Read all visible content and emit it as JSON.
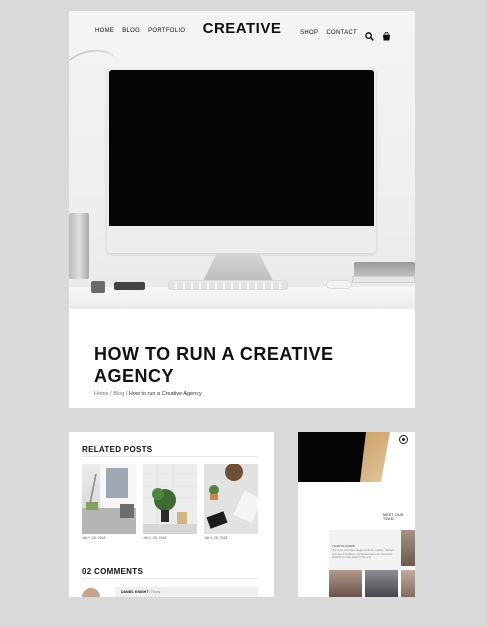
{
  "nav": {
    "left_links": [
      "HOME",
      "BLOG",
      "PORTFOLIO"
    ],
    "logo": "CREATIVE",
    "right_links": [
      "SHOP",
      "CONTACT"
    ],
    "icons": [
      "search-icon",
      "cart-icon"
    ]
  },
  "post": {
    "title": "HOW TO RUN A CREATIVE AGENCY",
    "breadcrumb": {
      "home": "Home",
      "sep": "/",
      "blog": "Blog",
      "current": "How to run a Creative Agency"
    }
  },
  "related": {
    "title": "RELATED POSTS",
    "posts": [
      {
        "date": "JULY, 25, 2018"
      },
      {
        "date": "JULY, 25, 2018"
      },
      {
        "date": "JULY, 25, 2018"
      }
    ]
  },
  "comments": {
    "title": "02 COMMENTS",
    "first_author": "DANIEL KNIGHT",
    "first_meta": "/ Reply"
  },
  "team": {
    "heading": "MEET OUR TEAM",
    "member_label": "TEAM PLAYERS",
    "member_text": "The Team Innovative design works for creative. Startups promotes innovations. And based gains our successful digital firms. New ideas for the end."
  },
  "colors": {
    "page_bg": "#d9d9d9",
    "card_bg": "#ffffff",
    "text": "#111111",
    "muted": "#777777",
    "accent_gold": "#c9a06a"
  }
}
